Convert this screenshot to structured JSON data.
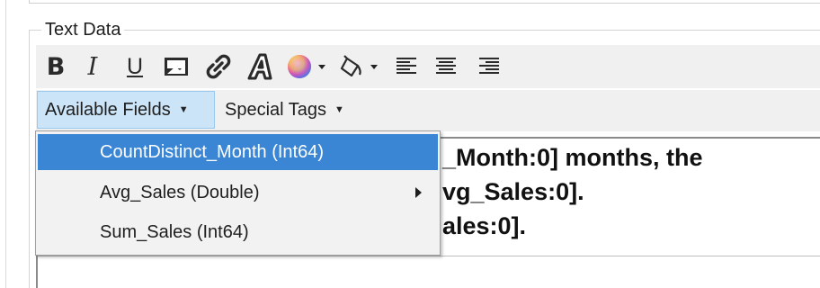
{
  "group": {
    "title": "Text Data"
  },
  "toolbar": {
    "bold_glyph": "B",
    "italic_glyph": "I",
    "underline_glyph": "U",
    "icons": [
      "bold-icon",
      "italic-icon",
      "underline-icon",
      "image-icon",
      "link-icon",
      "text-style-icon",
      "font-color-icon",
      "fill-color-icon",
      "align-left-icon",
      "align-center-icon",
      "align-right-icon"
    ]
  },
  "fields_toolbar": {
    "available_fields_label": "Available Fields",
    "special_tags_label": "Special Tags"
  },
  "menu": {
    "items": [
      {
        "label": "CountDistinct_Month (Int64)",
        "selected": true,
        "has_submenu": false
      },
      {
        "label": "Avg_Sales (Double)",
        "selected": false,
        "has_submenu": true
      },
      {
        "label": "Sum_Sales (Int64)",
        "selected": false,
        "has_submenu": false
      }
    ]
  },
  "editor": {
    "lines": [
      "_Month:0] months, the",
      "vg_Sales:0].",
      "ales:0]."
    ]
  },
  "colors": {
    "selection_blue": "#3a86d4",
    "button_hover_blue": "#cce4f7",
    "toolbar_gray": "#f0f0f0"
  }
}
